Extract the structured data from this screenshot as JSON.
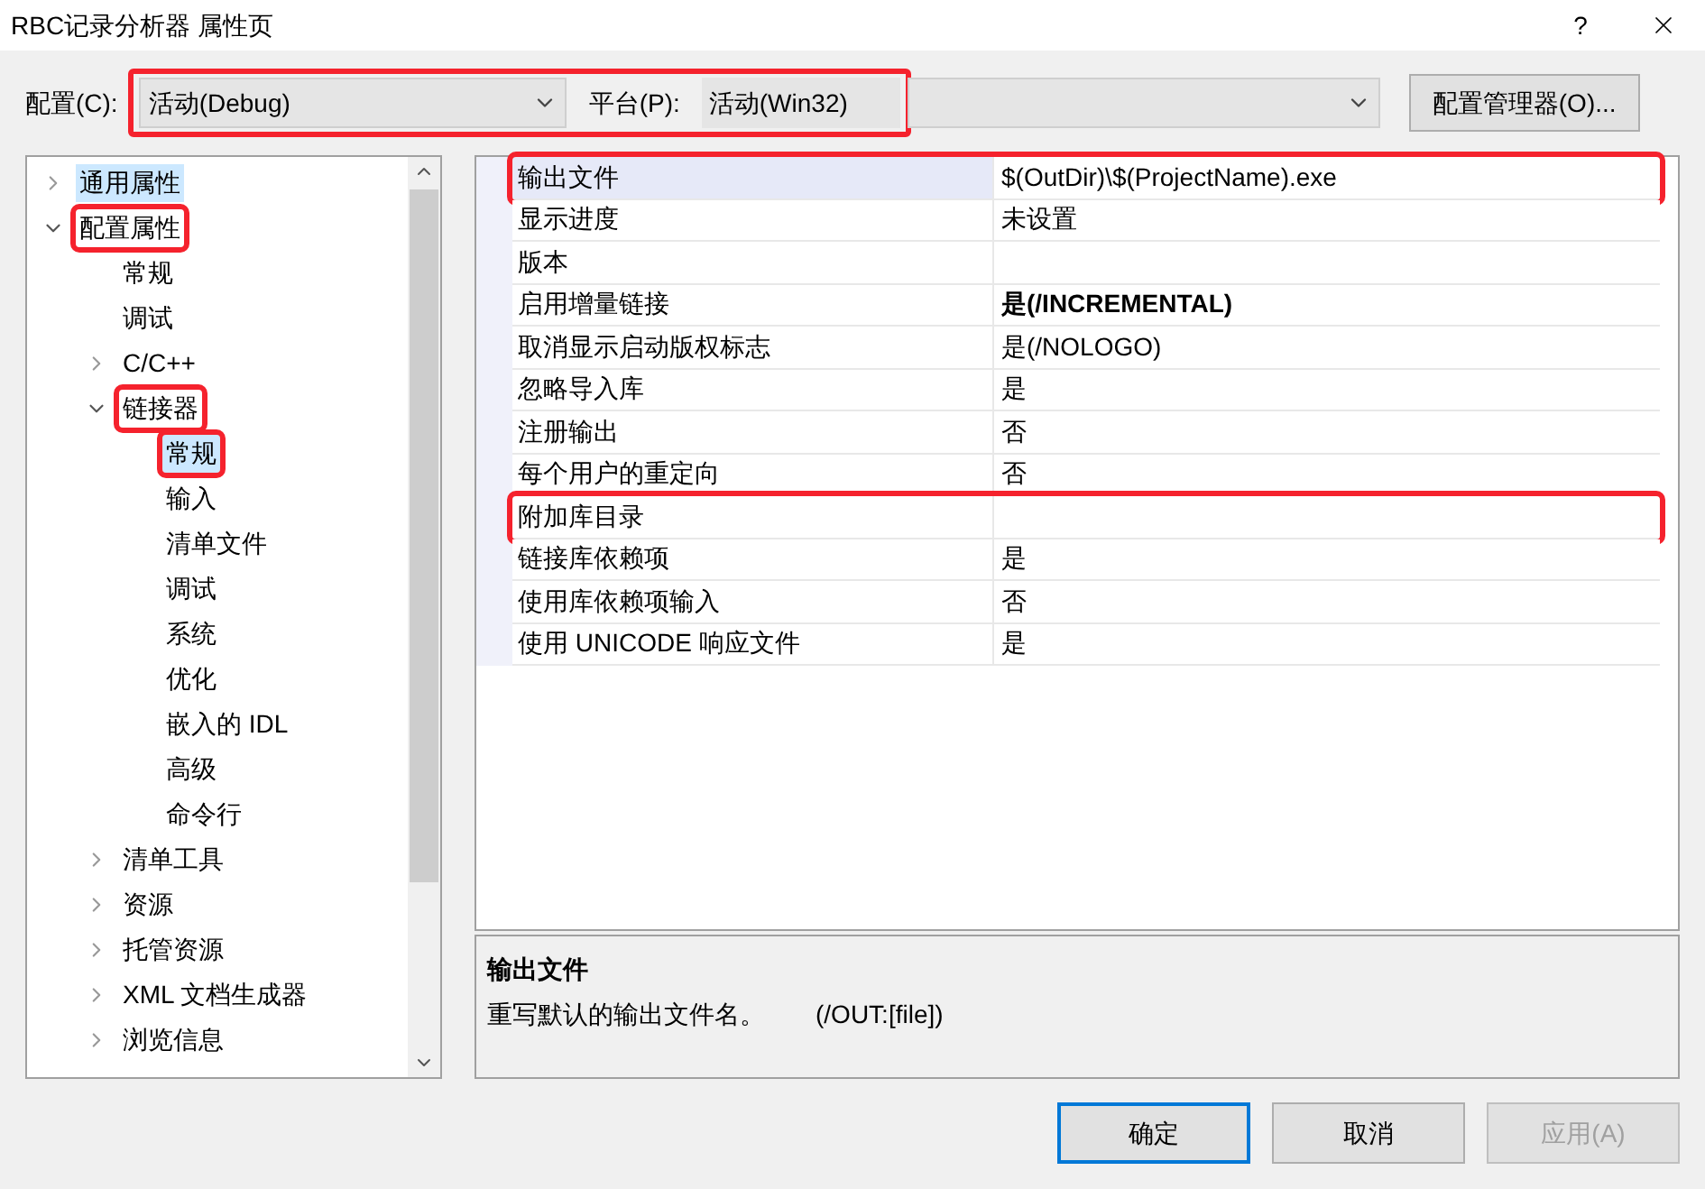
{
  "window": {
    "title": "RBC记录分析器 属性页",
    "help": "?"
  },
  "toolbar": {
    "annotated": true,
    "config_label": "配置(C):",
    "config_value": "活动(Debug)",
    "platform_label": "平台(P):",
    "platform_value": "活动(Win32)",
    "manager_button": "配置管理器(O)..."
  },
  "tree": [
    {
      "label": "通用属性",
      "expanded": false,
      "selected": true,
      "annotated": false
    },
    {
      "label": "配置属性",
      "expanded": true,
      "selected": false,
      "annotated": true,
      "children": [
        {
          "label": "常规",
          "selected": false,
          "annotated": false
        },
        {
          "label": "调试",
          "selected": false,
          "annotated": false
        },
        {
          "label": "C/C++",
          "expanded": false,
          "selected": false,
          "annotated": false
        },
        {
          "label": "链接器",
          "expanded": true,
          "selected": false,
          "annotated": true,
          "children": [
            {
              "label": "常规",
              "selected": true,
              "annotated": true
            },
            {
              "label": "输入",
              "selected": false,
              "annotated": false
            },
            {
              "label": "清单文件",
              "selected": false,
              "annotated": false
            },
            {
              "label": "调试",
              "selected": false,
              "annotated": false
            },
            {
              "label": "系统",
              "selected": false,
              "annotated": false
            },
            {
              "label": "优化",
              "selected": false,
              "annotated": false
            },
            {
              "label": "嵌入的 IDL",
              "selected": false,
              "annotated": false
            },
            {
              "label": "高级",
              "selected": false,
              "annotated": false
            },
            {
              "label": "命令行",
              "selected": false,
              "annotated": false
            }
          ]
        },
        {
          "label": "清单工具",
          "expanded": false,
          "selected": false,
          "annotated": false
        },
        {
          "label": "资源",
          "expanded": false,
          "selected": false,
          "annotated": false
        },
        {
          "label": "托管资源",
          "expanded": false,
          "selected": false,
          "annotated": false
        },
        {
          "label": "XML 文档生成器",
          "expanded": false,
          "selected": false,
          "annotated": false
        },
        {
          "label": "浏览信息",
          "expanded": false,
          "selected": false,
          "annotated": false
        }
      ]
    }
  ],
  "properties": [
    {
      "name": "输出文件",
      "value": "$(OutDir)\\$(ProjectName).exe",
      "selected": true,
      "annotated": true
    },
    {
      "name": "显示进度",
      "value": "未设置",
      "selected": false,
      "annotated": false
    },
    {
      "name": "版本",
      "selected": false,
      "annotated": false
    },
    {
      "name": "启用增量链接",
      "value": "是(/INCREMENTAL)",
      "selected": false,
      "bold": true,
      "annotated": false
    },
    {
      "name": "取消显示启动版权标志",
      "value": "是(/NOLOGO)",
      "selected": false,
      "annotated": false
    },
    {
      "name": "忽略导入库",
      "value": "是",
      "selected": false,
      "annotated": false
    },
    {
      "name": "注册输出",
      "value": "否",
      "selected": false,
      "annotated": false
    },
    {
      "name": "每个用户的重定向",
      "value": "否",
      "selected": false,
      "annotated": false
    },
    {
      "name": "附加库目录",
      "selected": false,
      "annotated": true
    },
    {
      "name": "链接库依赖项",
      "value": "是",
      "selected": false,
      "annotated": false
    },
    {
      "name": "使用库依赖项输入",
      "value": "否",
      "selected": false,
      "annotated": false
    },
    {
      "name": "使用 UNICODE 响应文件",
      "value": "是",
      "selected": false,
      "annotated": false
    }
  ],
  "description": {
    "title": "输出文件",
    "text": "重写默认的输出文件名。",
    "option_text": "(/OUT:[file])"
  },
  "buttons": [
    {
      "label": "确定",
      "kind": "default",
      "disabled": false
    },
    {
      "label": "取消",
      "kind": "normal",
      "disabled": false
    },
    {
      "label": "应用(A)",
      "kind": "normal",
      "disabled": true
    }
  ]
}
